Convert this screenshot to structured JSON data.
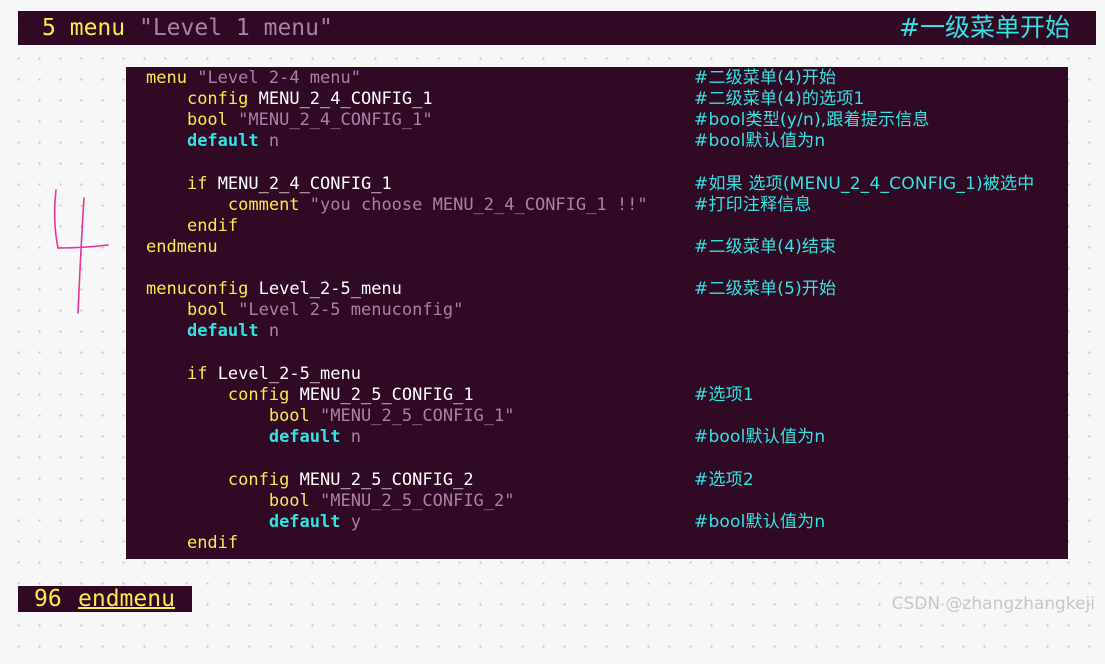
{
  "top_bar": {
    "line_number": "5",
    "keyword": "menu",
    "title_string": "\"Level 1 menu\"",
    "comment": "#一级菜单开始"
  },
  "code": {
    "l1": {
      "kw": "menu",
      "str": "\"Level 2-4 menu\"",
      "comment": "#二级菜单(4)开始"
    },
    "l2": {
      "kw": "config",
      "id": "MENU_2_4_CONFIG_1",
      "comment": "#二级菜单(4)的选项1"
    },
    "l3": {
      "kw": "bool",
      "str": "\"MENU_2_4_CONFIG_1\"",
      "comment": "#bool类型(y/n),跟着提示信息"
    },
    "l4": {
      "kw": "default",
      "val": "n",
      "comment": "#bool默认值为n"
    },
    "l5": {
      "kw": "if",
      "id": "MENU_2_4_CONFIG_1",
      "comment": "#如果 选项(MENU_2_4_CONFIG_1)被选中"
    },
    "l6": {
      "kw": "comment",
      "str": "\"you choose MENU_2_4_CONFIG_1 !!\"",
      "comment": "#打印注释信息"
    },
    "l7": {
      "kw": "endif"
    },
    "l8": {
      "kw": "endmenu",
      "comment": "#二级菜单(4)结束"
    },
    "l9": {
      "kw": "menuconfig",
      "id": "Level_2-5_menu",
      "comment": "#二级菜单(5)开始"
    },
    "l10": {
      "kw": "bool",
      "str": "\"Level 2-5 menuconfig\""
    },
    "l11": {
      "kw": "default",
      "val": "n"
    },
    "l12": {
      "kw": "if",
      "id": "Level_2-5_menu"
    },
    "l13": {
      "kw": "config",
      "id": "MENU_2_5_CONFIG_1",
      "comment": "#选项1"
    },
    "l14": {
      "kw": "bool",
      "str": "\"MENU_2_5_CONFIG_1\""
    },
    "l15": {
      "kw": "default",
      "val": "n",
      "comment": "#bool默认值为n"
    },
    "l16": {
      "kw": "config",
      "id": "MENU_2_5_CONFIG_2",
      "comment": "#选项2"
    },
    "l17": {
      "kw": "bool",
      "str": "\"MENU_2_5_CONFIG_2\""
    },
    "l18": {
      "kw": "default",
      "val": "y",
      "comment": "#bool默认值为n"
    },
    "l19": {
      "kw": "endif"
    }
  },
  "bottom_bar": {
    "line_number": "96",
    "keyword": "endmenu"
  },
  "annotation": {
    "handwritten": "4"
  },
  "watermark": "CSDN @zhangzhangkeji",
  "colors": {
    "background": "#300a24",
    "keyword": "#fce94f",
    "builtin": "#34e2e2",
    "string": "#ad7fa8",
    "annotation": "#e8349a"
  }
}
